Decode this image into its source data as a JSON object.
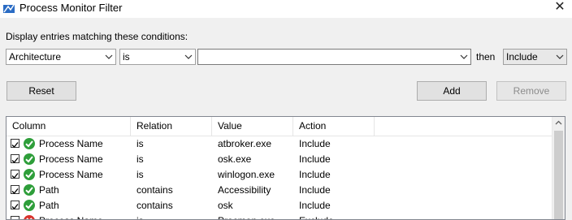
{
  "window": {
    "title": "Process Monitor Filter",
    "close_glyph": "✕"
  },
  "filter": {
    "caption": "Display entries matching these conditions:",
    "column_value": "Architecture",
    "relation_value": "is",
    "value_value": "",
    "then_label": "then",
    "action_value": "Include"
  },
  "buttons": {
    "reset": "Reset",
    "add": "Add",
    "remove": "Remove"
  },
  "table": {
    "headers": [
      "Column",
      "Relation",
      "Value",
      "Action"
    ],
    "rows": [
      {
        "checked": true,
        "status": "include",
        "column": "Process Name",
        "relation": "is",
        "value": "atbroker.exe",
        "action": "Include"
      },
      {
        "checked": true,
        "status": "include",
        "column": "Process Name",
        "relation": "is",
        "value": "osk.exe",
        "action": "Include"
      },
      {
        "checked": true,
        "status": "include",
        "column": "Process Name",
        "relation": "is",
        "value": "winlogon.exe",
        "action": "Include"
      },
      {
        "checked": true,
        "status": "include",
        "column": "Path",
        "relation": "contains",
        "value": "Accessibility",
        "action": "Include"
      },
      {
        "checked": true,
        "status": "include",
        "column": "Path",
        "relation": "contains",
        "value": "osk",
        "action": "Include"
      },
      {
        "checked": true,
        "status": "exclude",
        "column": "Process Name",
        "relation": "is",
        "value": "Procmon.exe",
        "action": "Exclude"
      }
    ]
  },
  "colors": {
    "include_icon": "#2e9e3a",
    "exclude_icon": "#d8322c",
    "titlebar_icon": "#2b6cc4"
  }
}
